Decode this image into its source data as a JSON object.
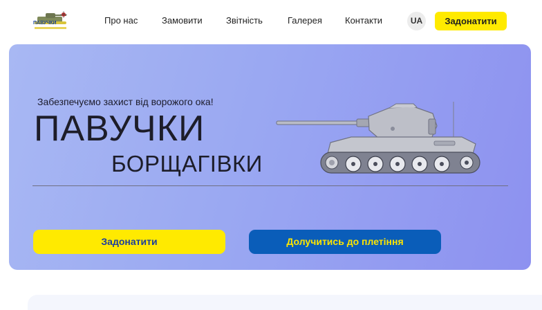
{
  "header": {
    "logo_text": "ПАВУЧКИ",
    "nav": [
      {
        "label": "Про нас"
      },
      {
        "label": "Замовити"
      },
      {
        "label": "Звітність"
      },
      {
        "label": "Галерея"
      },
      {
        "label": "Контакти"
      }
    ],
    "lang": "UA",
    "donate_label": "Задонатити"
  },
  "hero": {
    "tagline": "Забезпечуємо захист від ворожого ока!",
    "title_line1": "ПАВУЧКИ",
    "title_line2": "БОРЩАГІВКИ",
    "donate_button": "Задонатити",
    "join_button": "Долучитись до плетіння"
  },
  "colors": {
    "accent_yellow": "#ffea00",
    "accent_blue": "#0a5db9",
    "hero_gradient_start": "#a8b8f3",
    "hero_gradient_end": "#8d91f0"
  }
}
